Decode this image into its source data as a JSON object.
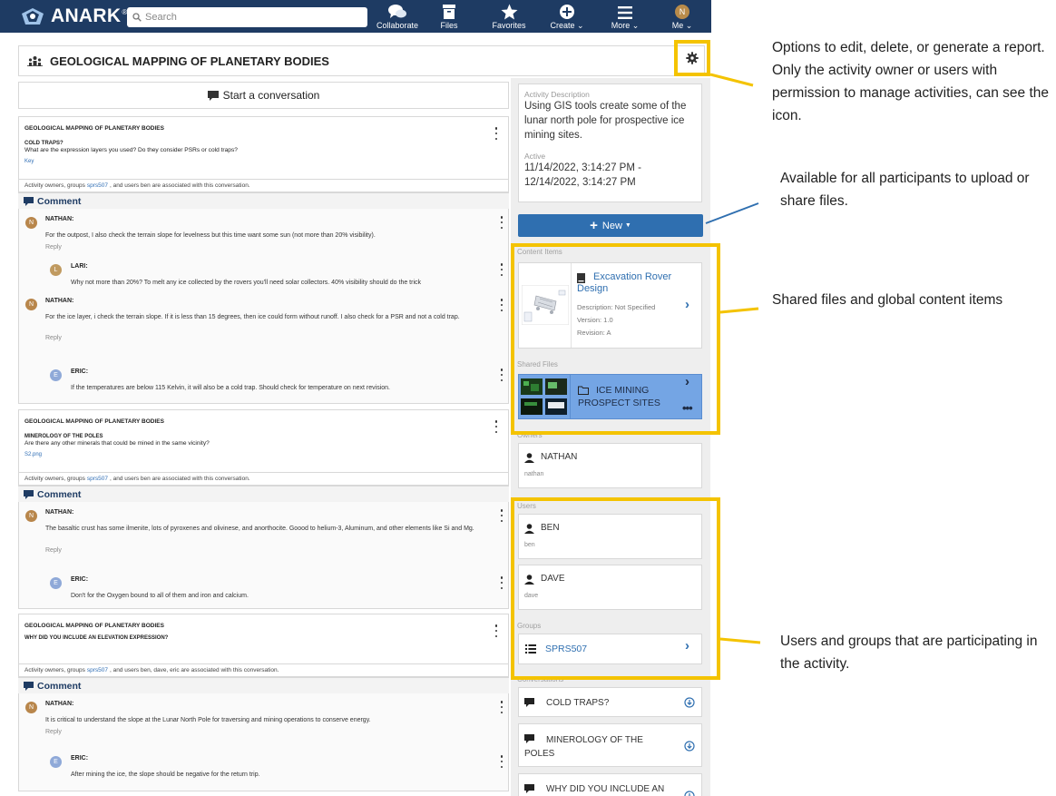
{
  "topbar": {
    "logo": "ANARK",
    "logo_mark": "®",
    "search_placeholder": "Search",
    "nav": [
      {
        "label": "Collaborate",
        "icon": "chat-bubbles-icon"
      },
      {
        "label": "Files",
        "icon": "archive-box-icon"
      },
      {
        "label": "Favorites",
        "icon": "star-icon"
      },
      {
        "label": "Create",
        "icon": "plus-circle-icon"
      },
      {
        "label": "More",
        "icon": "hamburger-menu-icon"
      },
      {
        "label": "Me",
        "icon": "avatar",
        "initial": "N"
      }
    ]
  },
  "activity": {
    "title": "GEOLOGICAL MAPPING OF PLANETARY BODIES",
    "icon": "group-people-icon"
  },
  "start_conversation": "Start a conversation",
  "conversations": [
    {
      "activity": "GEOLOGICAL MAPPING OF PLANETARY BODIES",
      "topic": "COLD TRAPS?",
      "question": "What are the expression layers you used? Do they consider PSRs or cold traps?",
      "attachment": "Key",
      "assoc_pre": "Activity owners, groups",
      "assoc_group": "sprs507",
      "assoc_post": ", and users ben are associated with this conversation.",
      "comment_label": "Comment",
      "comments": [
        {
          "initial": "N",
          "name": "NATHAN:",
          "text": "For the outpost, I also check the terrain slope for levelness but this time want some sun (not more than 20% visibility).",
          "reply": "Reply"
        },
        {
          "initial": "L",
          "name": "LARI:",
          "text": "Why not more than 20%? To melt any ice collected by the rovers you'll need solar collectors. 40% visibility should do the trick"
        },
        {
          "initial": "N",
          "name": "NATHAN:",
          "text": "For the ice layer, i check the terrain slope. If it is less than 15 degrees, then ice could form without runoff. I also check for a PSR and not a cold trap.",
          "reply": "Reply"
        },
        {
          "initial": "E",
          "name": "ERIC:",
          "text": "If the temperatures are below 115 Kelvin, it will also be a cold trap. Should check for temperature on next revision."
        }
      ]
    },
    {
      "activity": "GEOLOGICAL MAPPING OF PLANETARY BODIES",
      "topic": "MINEROLOGY OF THE POLES",
      "question": "Are there any other minerals that could be mined in the same vicinity?",
      "attachment": "S2.png",
      "assoc_pre": "Activity owners, groups",
      "assoc_group": "sprs507",
      "assoc_post": ", and users ben are associated with this conversation.",
      "comment_label": "Comment",
      "comments": [
        {
          "initial": "N",
          "name": "NATHAN:",
          "text": "The basaltic crust has some ilmenite, lots of pyroxenes and olivinese, and anorthocite. Goood to helium-3, Aluminum, and other elements like Si and Mg.",
          "reply": "Reply"
        },
        {
          "initial": "E",
          "name": "ERIC:",
          "text": "Don't for the Oxygen bound to all of them and iron and calcium."
        }
      ]
    },
    {
      "activity": "GEOLOGICAL MAPPING OF PLANETARY BODIES",
      "topic": "WHY DID YOU INCLUDE AN ELEVATION EXPRESSION?",
      "assoc_pre": "Activity owners, groups",
      "assoc_group": "sprs507",
      "assoc_post": ", and users ben, dave, eric are associated with this conversation.",
      "comment_label": "Comment",
      "comments": [
        {
          "initial": "N",
          "name": "NATHAN:",
          "text": "It is critical to understand the slope at the Lunar North Pole for traversing and mining operations to conserve energy.",
          "reply": "Reply"
        },
        {
          "initial": "E",
          "name": "ERIC:",
          "text": "After mining the ice, the slope should be negative for the return trip."
        }
      ]
    }
  ],
  "sidebar": {
    "description_label": "Activity Description",
    "description": "Using GIS tools create some of the lunar north pole for prospective ice mining sites.",
    "active_label": "Active",
    "active_range": "11/14/2022, 3:14:27 PM - 12/14/2022, 3:14:27 PM",
    "new_button": "New",
    "content_items_label": "Content Items",
    "content_item": {
      "title": "Excavation Rover Design",
      "description": "Description: Not Specified",
      "version": "Version: 1.0",
      "revision": "Revision: A"
    },
    "shared_files_label": "Shared Files",
    "shared_file": {
      "name": "ICE MINING PROSPECT SITES"
    },
    "owners_label": "Owners",
    "owners": [
      {
        "name": "NATHAN",
        "id": "nathan"
      }
    ],
    "users_label": "Users",
    "users": [
      {
        "name": "BEN",
        "id": "ben"
      },
      {
        "name": "DAVE",
        "id": "dave"
      }
    ],
    "groups_label": "Groups",
    "groups": [
      {
        "name": "SPRS507"
      }
    ],
    "conversations_label": "Conversations",
    "conversation_links": [
      "COLD TRAPS?",
      "MINEROLOGY OF THE POLES",
      "WHY DID YOU INCLUDE AN"
    ]
  },
  "annotations": {
    "gear": "Options to edit, delete, or generate a report. Only the activity owner or users with permission to manage activities, can see the icon.",
    "new": "Available for all participants to upload or share files.",
    "content": "Shared files and global content items",
    "users": "Users and groups that are participating in the activity."
  },
  "colors": {
    "topbar": "#1e3b63",
    "highlight": "#f4c300",
    "accent": "#2f6fb0",
    "file_card": "#74a5e4"
  }
}
